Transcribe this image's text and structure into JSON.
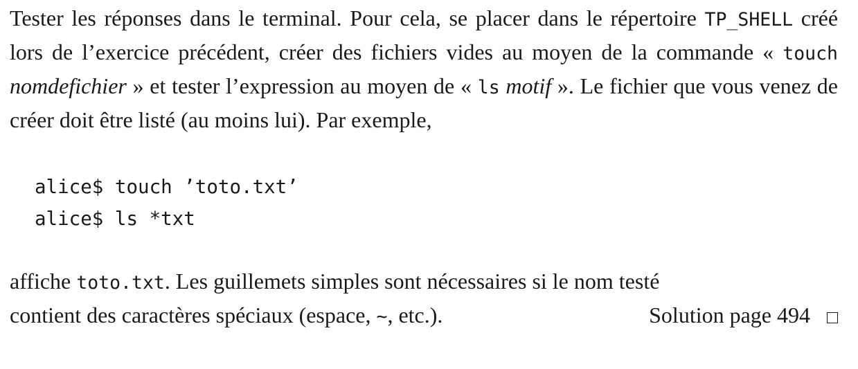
{
  "paragraph1": {
    "t1": "Tester les réponses dans le terminal. Pour cela, se placer dans le répertoire",
    "dir": "TP_SHELL",
    "t2": "créé lors de l’exercice précédent, créer des fichiers vides au moyen de la commande «",
    "cmd_touch": "touch",
    "arg_touch": "nomdefichier",
    "t3": "» et tester l’expression au moyen de «",
    "cmd_ls": "ls",
    "arg_ls": "motif",
    "t4": "». Le fichier que vous venez de créer doit être listé (au moins lui). Par exemple,"
  },
  "code": {
    "lines": [
      "alice$ touch ’toto.txt’",
      "alice$ ls *txt"
    ]
  },
  "paragraph2": {
    "t1": "affiche",
    "file": "toto.txt",
    "t2": ". Les guillemets simples sont nécessaires si le nom testé",
    "t3": "contient des caractères spéciaux (espace,",
    "tilde": "~",
    "t4": ", etc.).",
    "solution": "Solution page 494"
  }
}
